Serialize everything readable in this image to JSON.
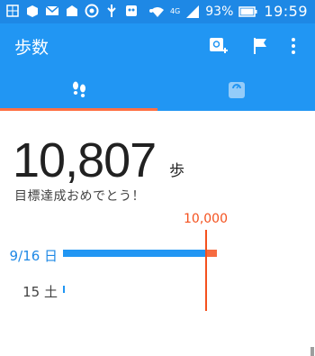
{
  "status_bar": {
    "battery": "93%",
    "time": "19:59",
    "network": "4G"
  },
  "app_bar": {
    "title": "歩数",
    "actions": [
      "add-weight-icon",
      "flag-icon",
      "more-vert-icon"
    ]
  },
  "tabs": [
    {
      "icon": "footsteps-icon",
      "selected": true
    },
    {
      "icon": "scale-icon",
      "selected": false
    }
  ],
  "summary": {
    "steps": "10,807",
    "unit": "歩",
    "message": "目標達成おめでとう！"
  },
  "chart_data": {
    "type": "bar",
    "orientation": "horizontal",
    "goal": 10000,
    "goal_label": "10,000",
    "rows": [
      {
        "label": "9/16 日",
        "value": 10807,
        "highlight": true
      },
      {
        "label": "15 土",
        "value": 0,
        "highlight": false
      }
    ]
  },
  "colors": {
    "primary": "#2196f3",
    "primary_dark": "#1e88e5",
    "accent": "#f4511e",
    "bar": "#2196f3",
    "text": "#212121"
  }
}
